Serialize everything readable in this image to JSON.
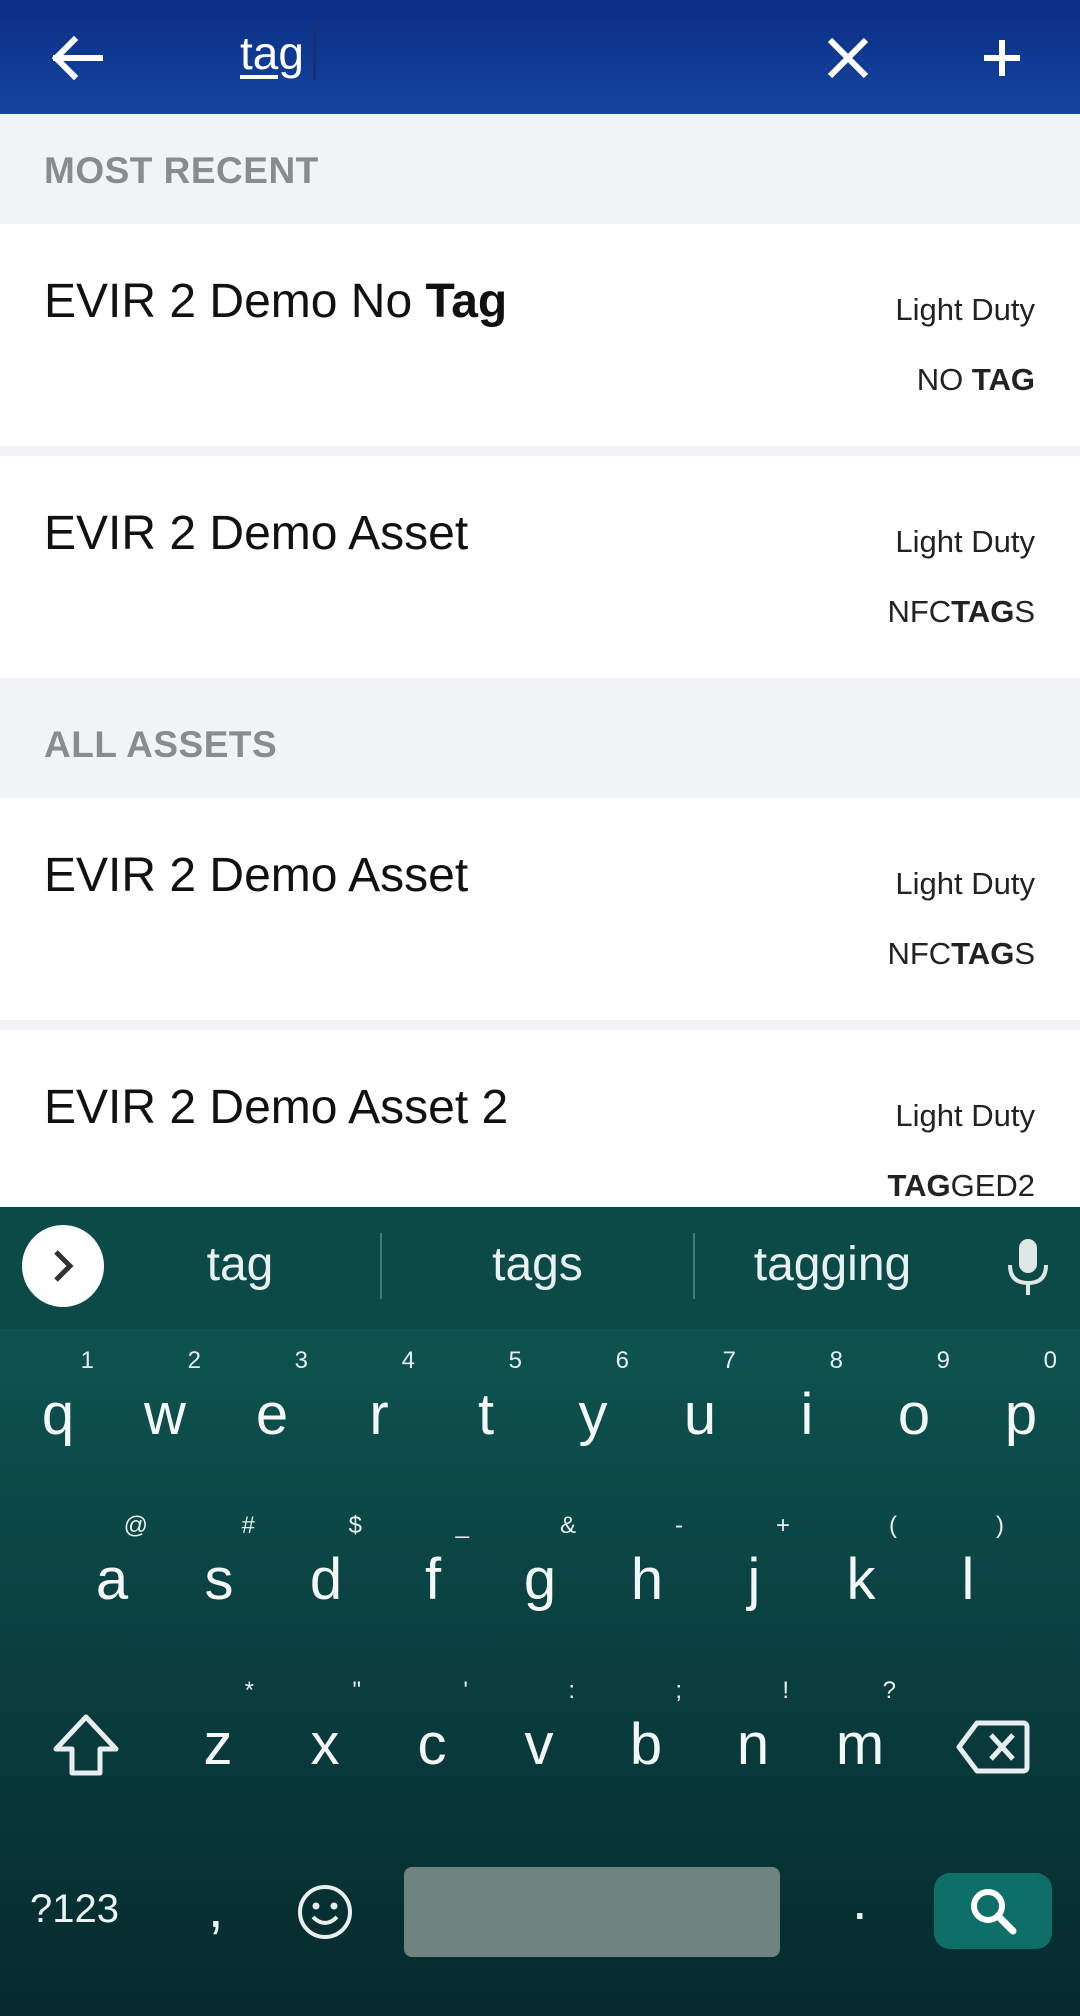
{
  "search": {
    "value": "tag"
  },
  "sections": {
    "most_recent": "MOST RECENT",
    "all_assets": "ALL ASSETS"
  },
  "rows": [
    {
      "name_pre": "EVIR 2 Demo No ",
      "name_match": "Tag",
      "name_post": "",
      "type": "Light Duty",
      "tag_pre": "NO ",
      "tag_match": "TAG",
      "tag_post": ""
    },
    {
      "name_pre": "EVIR 2 Demo Asset",
      "name_match": "",
      "name_post": "",
      "type": "Light Duty",
      "tag_pre": "NFC",
      "tag_match": "TAG",
      "tag_post": "S"
    },
    {
      "name_pre": "EVIR 2 Demo Asset",
      "name_match": "",
      "name_post": "",
      "type": "Light Duty",
      "tag_pre": "NFC",
      "tag_match": "TAG",
      "tag_post": "S"
    },
    {
      "name_pre": "EVIR 2 Demo Asset 2",
      "name_match": "",
      "name_post": "",
      "type": "Light Duty",
      "tag_pre": "",
      "tag_match": "TAG",
      "tag_post": "GED2"
    }
  ],
  "keyboard": {
    "suggestions": [
      "tag",
      "tags",
      "tagging"
    ],
    "row1": [
      {
        "k": "q",
        "h": "1"
      },
      {
        "k": "w",
        "h": "2"
      },
      {
        "k": "e",
        "h": "3"
      },
      {
        "k": "r",
        "h": "4"
      },
      {
        "k": "t",
        "h": "5"
      },
      {
        "k": "y",
        "h": "6"
      },
      {
        "k": "u",
        "h": "7"
      },
      {
        "k": "i",
        "h": "8"
      },
      {
        "k": "o",
        "h": "9"
      },
      {
        "k": "p",
        "h": "0"
      }
    ],
    "row2": [
      {
        "k": "a",
        "h": "@"
      },
      {
        "k": "s",
        "h": "#"
      },
      {
        "k": "d",
        "h": "$"
      },
      {
        "k": "f",
        "h": "_"
      },
      {
        "k": "g",
        "h": "&"
      },
      {
        "k": "h",
        "h": "-"
      },
      {
        "k": "j",
        "h": "+"
      },
      {
        "k": "k",
        "h": "("
      },
      {
        "k": "l",
        "h": ")"
      }
    ],
    "row3": [
      {
        "k": "z",
        "h": "*"
      },
      {
        "k": "x",
        "h": "\""
      },
      {
        "k": "c",
        "h": "'"
      },
      {
        "k": "v",
        "h": ":"
      },
      {
        "k": "b",
        "h": ";"
      },
      {
        "k": "n",
        "h": "!"
      },
      {
        "k": "m",
        "h": "?"
      }
    ],
    "symbols_label": "?123",
    "comma": ",",
    "period": "."
  },
  "colors": {
    "appbar": "#0a2d86",
    "keyboard": "#0a3f40",
    "search_key": "#0e6f69"
  }
}
